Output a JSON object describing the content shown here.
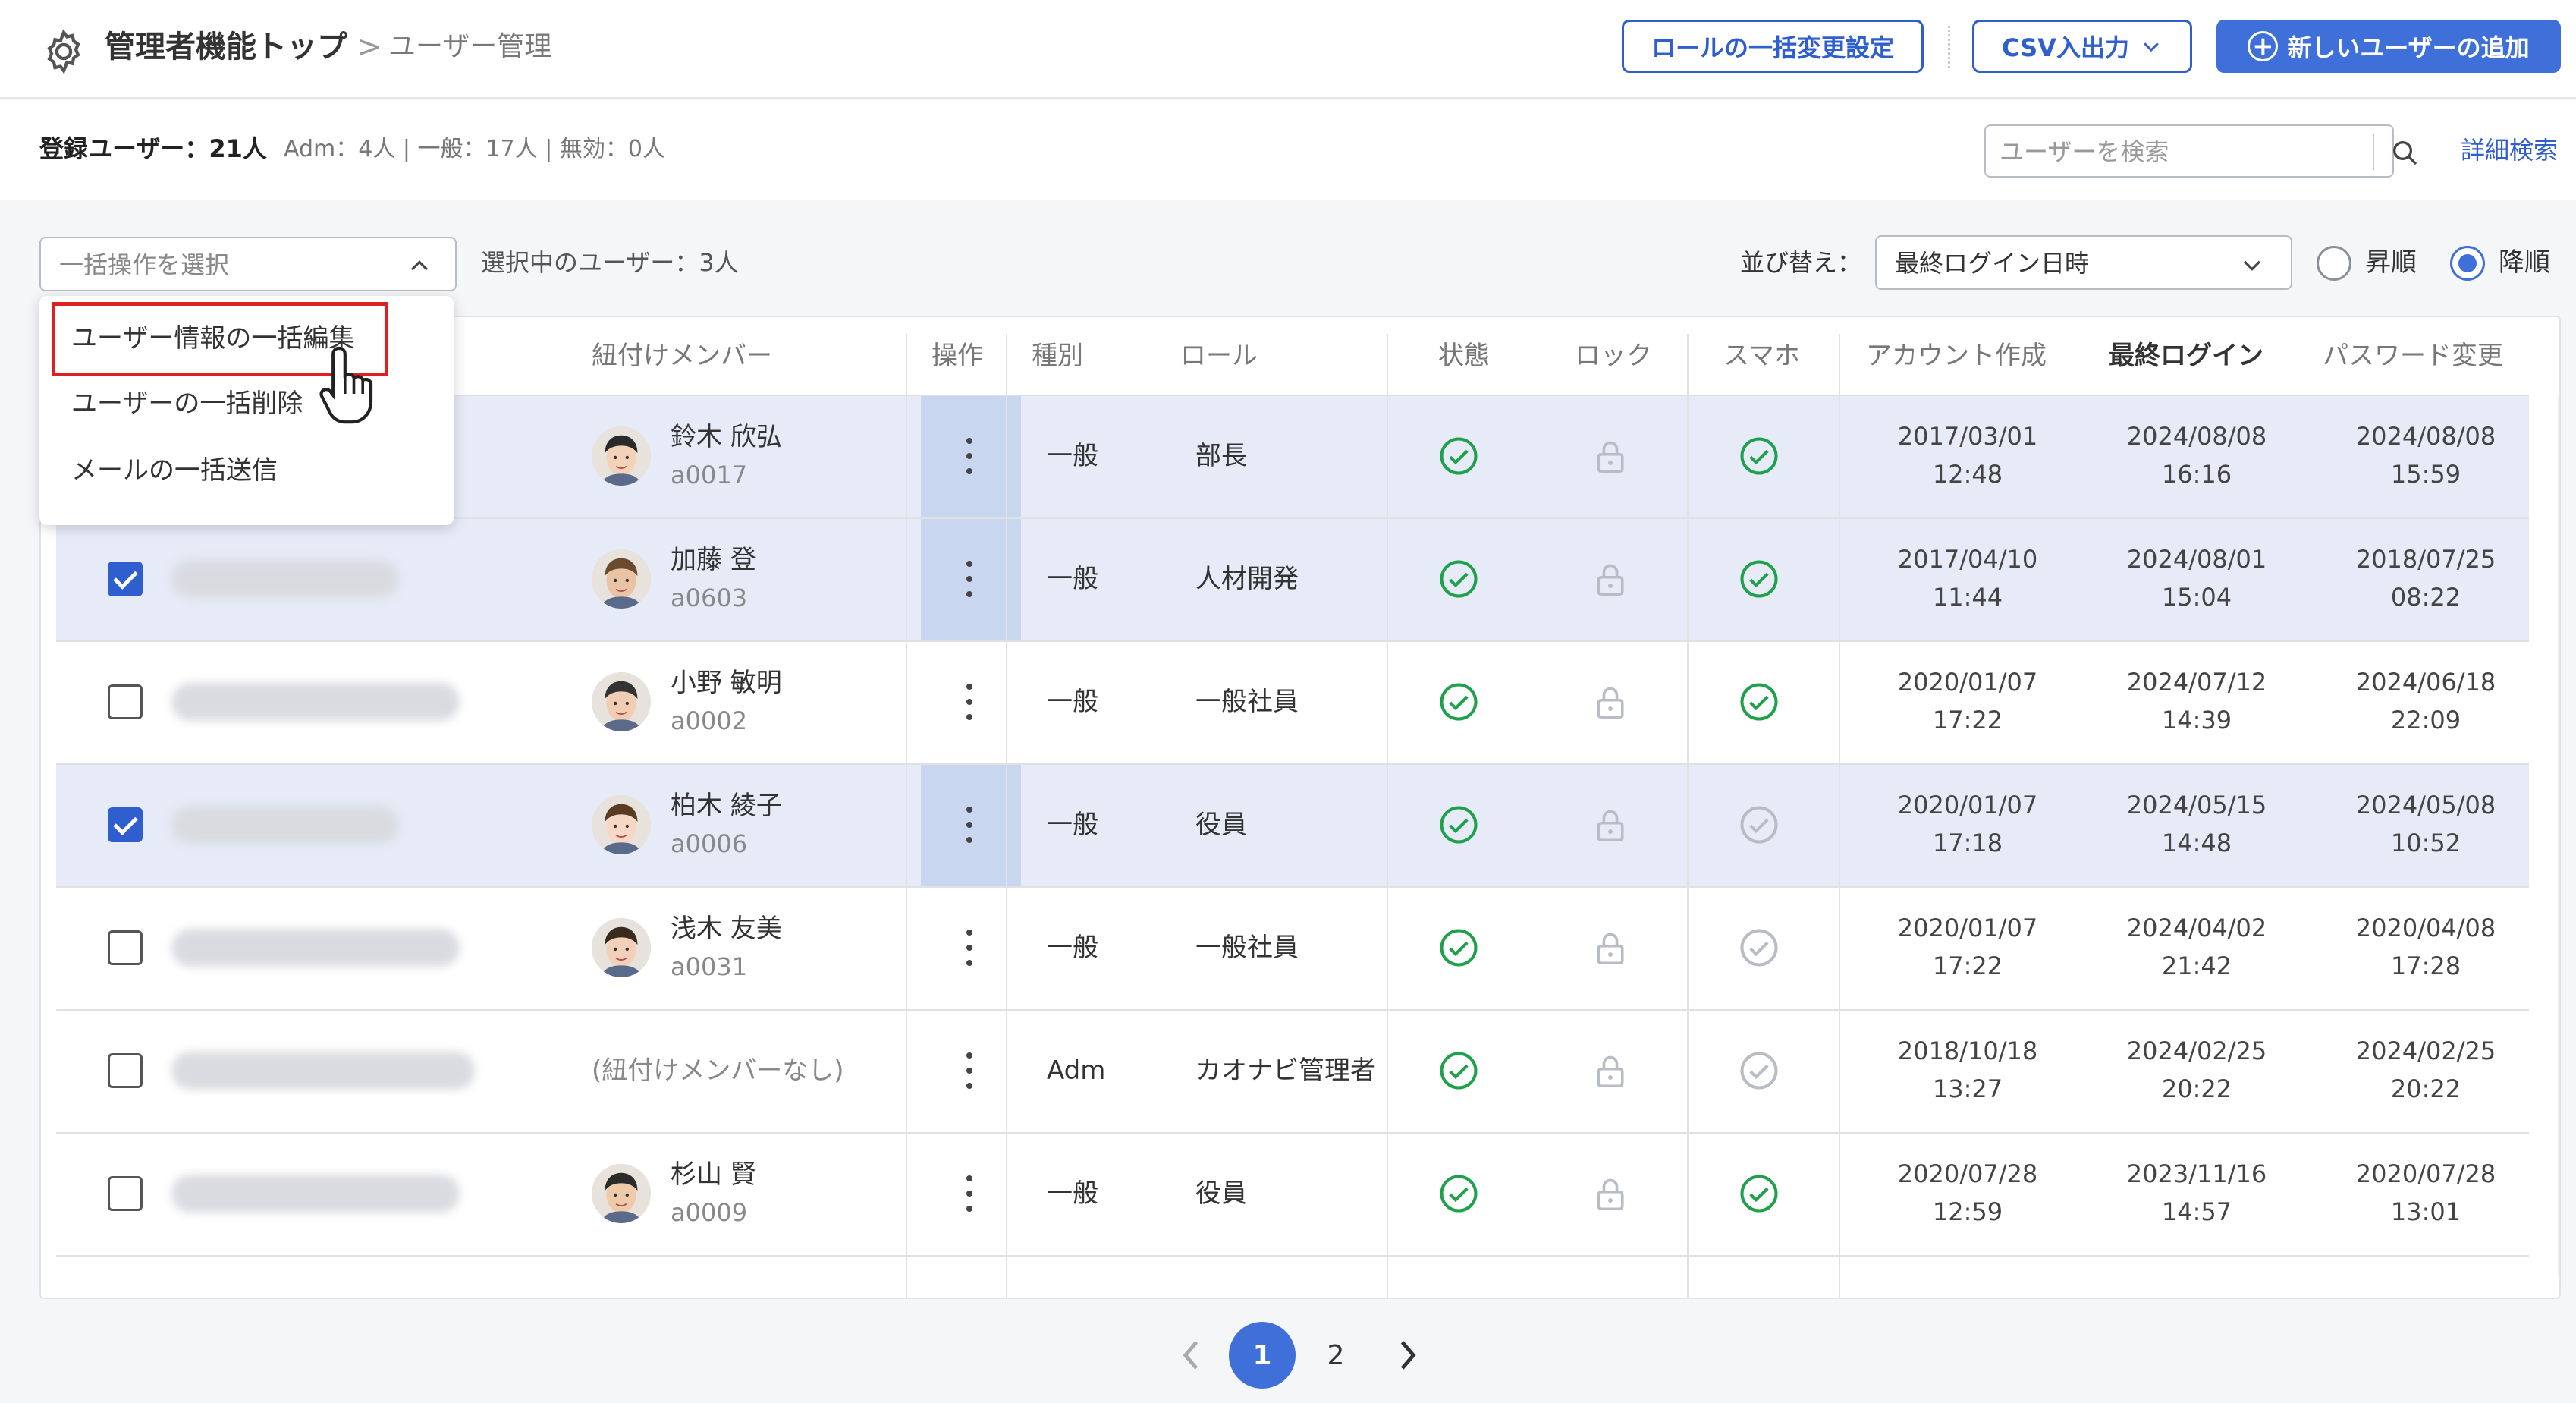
{
  "header": {
    "title": "管理者機能トップ",
    "separator": ">",
    "current": "ユーザー管理",
    "role_bulk_button": "ロールの一括変更設定",
    "csv_button": "CSV入出力",
    "add_user_button": "新しいユーザーの追加"
  },
  "summary": {
    "registered": "登録ユーザー：21人",
    "breakdown": "Adm：4人 | 一般：17人 | 無効：0人"
  },
  "search": {
    "placeholder": "ユーザーを検索",
    "advanced_link": "詳細検索"
  },
  "bulk": {
    "placeholder": "一括操作を選択",
    "selected_count": "選択中のユーザー：3人",
    "menu": [
      "ユーザー情報の一括編集",
      "ユーザーの一括削除",
      "メールの一括送信"
    ]
  },
  "sort": {
    "label": "並び替え：",
    "selected": "最終ログイン日時",
    "asc_label": "昇順",
    "desc_label": "降順",
    "order": "desc"
  },
  "table": {
    "headers": {
      "member": "紐付けメンバー",
      "ops": "操作",
      "type": "種別",
      "role": "ロール",
      "status": "状態",
      "lock": "ロック",
      "smartphone": "スマホ",
      "account_created": "アカウント作成",
      "last_login": "最終ログイン",
      "password_changed": "パスワード変更"
    },
    "rows": [
      {
        "selected": true,
        "checkbox_visible": false,
        "member_name": "鈴木 欣弘",
        "member_id": "a0017",
        "type": "一般",
        "role": "部長",
        "status": "active",
        "lock": "unlocked",
        "smartphone": "enabled",
        "created": "2017/03/01\n12:48",
        "last_login": "2024/08/08\n16:16",
        "pw_changed": "2024/08/08\n15:59"
      },
      {
        "selected": true,
        "checkbox_visible": true,
        "member_name": "加藤 登",
        "member_id": "a0603",
        "type": "一般",
        "role": "人材開発",
        "status": "active",
        "lock": "unlocked",
        "smartphone": "enabled",
        "created": "2017/04/10\n11:44",
        "last_login": "2024/08/01\n15:04",
        "pw_changed": "2018/07/25\n08:22"
      },
      {
        "selected": false,
        "checkbox_visible": true,
        "member_name": "小野 敏明",
        "member_id": "a0002",
        "type": "一般",
        "role": "一般社員",
        "status": "active",
        "lock": "unlocked",
        "smartphone": "enabled",
        "created": "2020/01/07\n17:22",
        "last_login": "2024/07/12\n14:39",
        "pw_changed": "2024/06/18\n22:09"
      },
      {
        "selected": true,
        "checkbox_visible": true,
        "member_name": "柏木 綾子",
        "member_id": "a0006",
        "type": "一般",
        "role": "役員",
        "status": "active",
        "lock": "unlocked",
        "smartphone": "disabled",
        "created": "2020/01/07\n17:18",
        "last_login": "2024/05/15\n14:48",
        "pw_changed": "2024/05/08\n10:52"
      },
      {
        "selected": false,
        "checkbox_visible": true,
        "member_name": "浅木 友美",
        "member_id": "a0031",
        "type": "一般",
        "role": "一般社員",
        "status": "active",
        "lock": "unlocked",
        "smartphone": "disabled",
        "created": "2020/01/07\n17:22",
        "last_login": "2024/04/02\n21:42",
        "pw_changed": "2020/04/08\n17:28"
      },
      {
        "selected": false,
        "checkbox_visible": true,
        "member_name": "",
        "member_id": "",
        "no_member": "(紐付けメンバーなし)",
        "type": "Adm",
        "role": "カオナビ管理者",
        "status": "active",
        "lock": "unlocked",
        "smartphone": "disabled",
        "created": "2018/10/18\n13:27",
        "last_login": "2024/02/25\n20:22",
        "pw_changed": "2024/02/25\n20:22"
      },
      {
        "selected": false,
        "checkbox_visible": true,
        "member_name": "杉山 賢",
        "member_id": "a0009",
        "type": "一般",
        "role": "役員",
        "status": "active",
        "lock": "unlocked",
        "smartphone": "enabled",
        "created": "2020/07/28\n12:59",
        "last_login": "2023/11/16\n14:57",
        "pw_changed": "2020/07/28\n13:01"
      }
    ]
  },
  "pagination": {
    "pages": [
      "1",
      "2"
    ],
    "current": "1"
  },
  "colors": {
    "accent": "#3f6fd8",
    "selected_row": "#e6ebf7",
    "ops_selected": "#c9d6f0",
    "ok_green": "#1fa04a",
    "muted_gray": "#b8bcc4",
    "highlight_red": "#e02020"
  }
}
